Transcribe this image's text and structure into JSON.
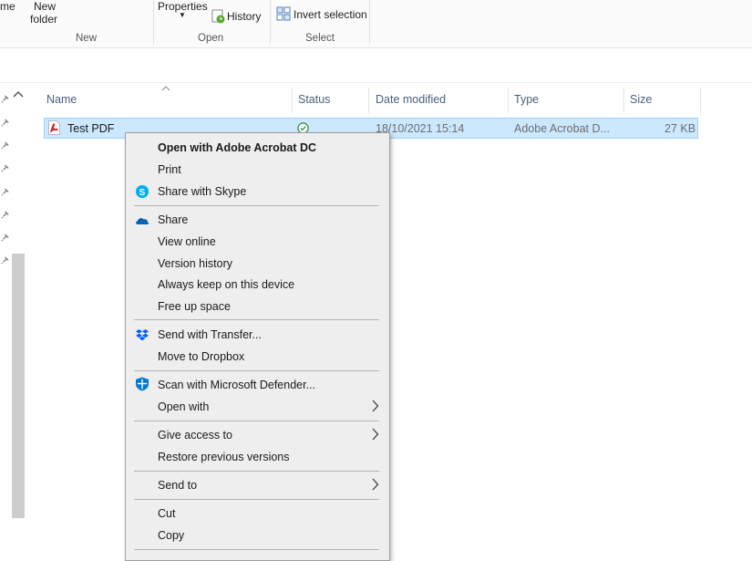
{
  "ribbon": {
    "partial_left_label": "me",
    "new_folder_line1": "New",
    "new_folder_line2": "folder",
    "group_new": "New",
    "properties_label": "Properties",
    "history_label": "History",
    "group_open": "Open",
    "invert_selection_label": "Invert selection",
    "group_select": "Select"
  },
  "columns": {
    "name": "Name",
    "status": "Status",
    "date_modified": "Date modified",
    "type": "Type",
    "size": "Size"
  },
  "file": {
    "name": "Test PDF",
    "date_modified": "18/10/2021 15:14",
    "type": "Adobe Acrobat D...",
    "size": "27 KB"
  },
  "context_menu": {
    "open_with_acrobat": "Open with Adobe Acrobat DC",
    "print": "Print",
    "share_with_skype": "Share with Skype",
    "share": "Share",
    "view_online": "View online",
    "version_history": "Version history",
    "always_keep": "Always keep on this device",
    "free_up_space": "Free up space",
    "send_with_transfer": "Send with Transfer...",
    "move_to_dropbox": "Move to Dropbox",
    "scan_defender": "Scan with Microsoft Defender...",
    "open_with": "Open with",
    "give_access_to": "Give access to",
    "restore_previous_versions": "Restore previous versions",
    "send_to": "Send to",
    "cut": "Cut",
    "copy": "Copy"
  },
  "colors": {
    "selection_bg": "#cce8ff",
    "selection_border": "#99d1ff",
    "header_text": "#4c607a",
    "menu_bg": "#eeeeee",
    "skype_blue": "#00aff0",
    "onedrive_blue": "#0364b8",
    "dropbox_blue": "#0061fe",
    "defender_blue": "#0078d4",
    "status_green": "#2e8b3a"
  },
  "icons": {
    "pdf": "pdf-file-icon",
    "status": "synced-check-icon",
    "skype": "skype-icon",
    "onedrive": "onedrive-cloud-icon",
    "dropbox": "dropbox-icon",
    "defender": "defender-shield-icon",
    "submenu": "chevron-right-icon"
  }
}
